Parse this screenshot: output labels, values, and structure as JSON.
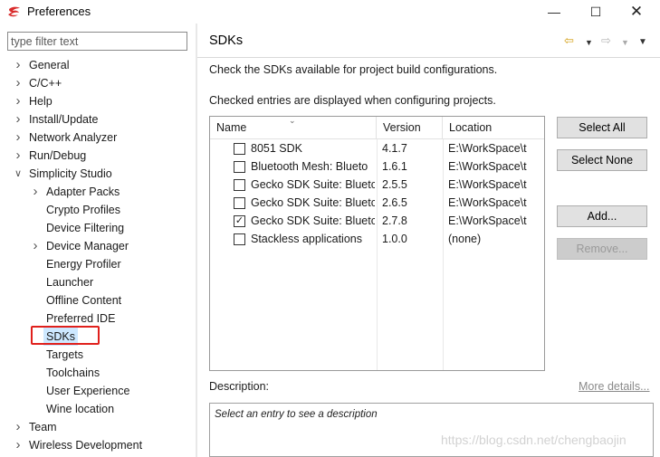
{
  "window": {
    "title": "Preferences"
  },
  "filter": {
    "placeholder": "type filter text",
    "value": ""
  },
  "tree": {
    "items": [
      {
        "label": "General",
        "expandable": true,
        "expanded": false
      },
      {
        "label": "C/C++",
        "expandable": true,
        "expanded": false
      },
      {
        "label": "Help",
        "expandable": true,
        "expanded": false
      },
      {
        "label": "Install/Update",
        "expandable": true,
        "expanded": false
      },
      {
        "label": "Network Analyzer",
        "expandable": true,
        "expanded": false
      },
      {
        "label": "Run/Debug",
        "expandable": true,
        "expanded": false
      },
      {
        "label": "Simplicity Studio",
        "expandable": true,
        "expanded": true
      },
      {
        "label": "Adapter Packs",
        "expandable": true,
        "expanded": false
      },
      {
        "label": "Crypto Profiles",
        "expandable": false
      },
      {
        "label": "Device Filtering",
        "expandable": false
      },
      {
        "label": "Device Manager",
        "expandable": true,
        "expanded": false
      },
      {
        "label": "Energy Profiler",
        "expandable": false
      },
      {
        "label": "Launcher",
        "expandable": false
      },
      {
        "label": "Offline Content",
        "expandable": false
      },
      {
        "label": "Preferred IDE",
        "expandable": false
      },
      {
        "label": "SDKs",
        "expandable": false,
        "selected": true
      },
      {
        "label": "Targets",
        "expandable": false
      },
      {
        "label": "Toolchains",
        "expandable": false
      },
      {
        "label": "User Experience",
        "expandable": false
      },
      {
        "label": "Wine location",
        "expandable": false
      },
      {
        "label": "Team",
        "expandable": true,
        "expanded": false
      },
      {
        "label": "Wireless Development",
        "expandable": true,
        "expanded": false
      }
    ]
  },
  "page": {
    "title": "SDKs",
    "description_1": "Check the SDKs available for project build configurations.",
    "description_2": "Checked entries are displayed when configuring projects."
  },
  "table": {
    "columns": [
      "Name",
      "Version",
      "Location"
    ],
    "rows": [
      {
        "checked": false,
        "name": "8051 SDK",
        "version": "4.1.7",
        "location": "E:\\WorkSpace\\t"
      },
      {
        "checked": false,
        "name": "Bluetooth Mesh: Blueto",
        "version": "1.6.1",
        "location": "E:\\WorkSpace\\t"
      },
      {
        "checked": false,
        "name": "Gecko SDK Suite: Bluetc",
        "version": "2.5.5",
        "location": "E:\\WorkSpace\\t"
      },
      {
        "checked": false,
        "name": "Gecko SDK Suite: Bluetc",
        "version": "2.6.5",
        "location": "E:\\WorkSpace\\t"
      },
      {
        "checked": true,
        "name": "Gecko SDK Suite: Bluetc",
        "version": "2.7.8",
        "location": "E:\\WorkSpace\\t"
      },
      {
        "checked": false,
        "name": "Stackless applications",
        "version": "1.0.0",
        "location": "(none)"
      }
    ]
  },
  "buttons": {
    "select_all": "Select All",
    "select_none": "Select None",
    "add": "Add...",
    "remove": "Remove..."
  },
  "details": {
    "label": "Description:",
    "more_link": "More details...",
    "placeholder": "Select an entry to see a description"
  },
  "watermark": "https://blog.csdn.net/chengbaojin",
  "colors": {
    "selection_bg": "#cde8ff",
    "highlight_outline": "#e0201c",
    "nav_back": "#d4a017"
  }
}
